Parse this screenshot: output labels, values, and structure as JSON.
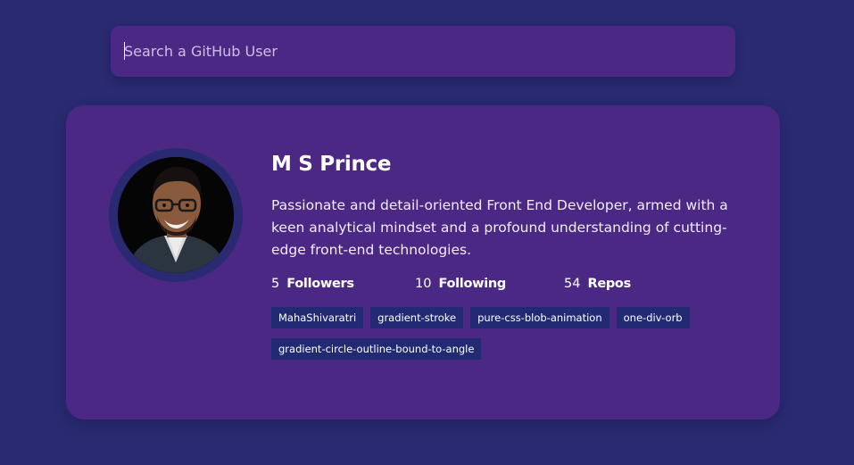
{
  "search": {
    "placeholder": "Search a GitHub User",
    "value": ""
  },
  "profile": {
    "name": "M S Prince",
    "bio": "Passionate and detail-oriented Front End Developer, armed with a keen analytical mindset and a profound understanding of cutting-edge front-end technologies.",
    "avatar_icon": "user-avatar-photo",
    "stats": {
      "followers": {
        "value": "5",
        "label": "Followers"
      },
      "following": {
        "value": "10",
        "label": "Following"
      },
      "repos": {
        "value": "54",
        "label": "Repos"
      }
    },
    "repos": [
      "MahaShivaratri",
      "gradient-stroke",
      "pure-css-blob-animation",
      "one-div-orb",
      "gradient-circle-outline-bound-to-angle"
    ]
  },
  "colors": {
    "background": "#2a2a72",
    "card": "#4c2885",
    "repo_tag": "#212a72"
  }
}
